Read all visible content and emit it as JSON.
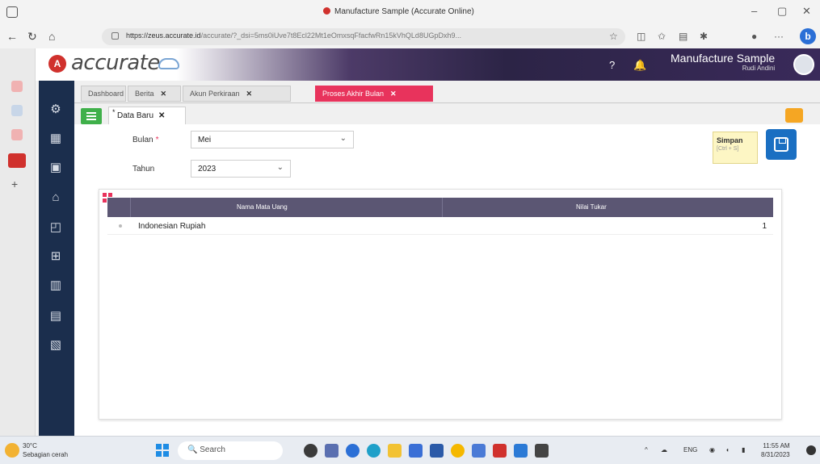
{
  "browser": {
    "title": "Manufacture Sample (Accurate Online)",
    "url_host": "https://zeus.accurate.id",
    "url_path": "/accurate/?_dsi=5ms0iUve7t8Ecl22Mt1eOmxsqFfacfwRn15kVhQLd8UGpDxh9...",
    "tab_icon": "accurate-logo-icon"
  },
  "app": {
    "brand": "accurate",
    "company_name": "Manufacture Sample",
    "company_sub": "Rudi Andini",
    "tabs": [
      {
        "label": "Dashboard",
        "closable": false,
        "active": false
      },
      {
        "label": "Berita",
        "closable": true,
        "active": false
      },
      {
        "label": "Akun Perkiraan",
        "closable": true,
        "active": false
      },
      {
        "label": "Proses Akhir Bulan",
        "closable": true,
        "active": true
      }
    ],
    "sub_tab": {
      "label": "Data Baru"
    }
  },
  "form": {
    "bulan_label": "Bulan",
    "bulan_value": "Mei",
    "tahun_label": "Tahun",
    "tahun_value": "2023",
    "save_label": "Simpan",
    "save_shortcut": "[Ctrl + S]"
  },
  "grid": {
    "columns": [
      "Nama Mata Uang",
      "Nilai Tukar"
    ],
    "rows": [
      {
        "currency": "Indonesian Rupiah",
        "rate": "1"
      }
    ]
  },
  "taskbar": {
    "weather_temp": "30°C",
    "weather_desc": "Sebagian cerah",
    "search_placeholder": "Search",
    "lang": "ENG",
    "time": "11:55 AM",
    "date": "8/31/2023"
  },
  "colors": {
    "accent_tab": "#e8335c",
    "sidebar": "#1b2e4d",
    "save_button": "#1a6fc2",
    "menu_button": "#3fb04a"
  }
}
